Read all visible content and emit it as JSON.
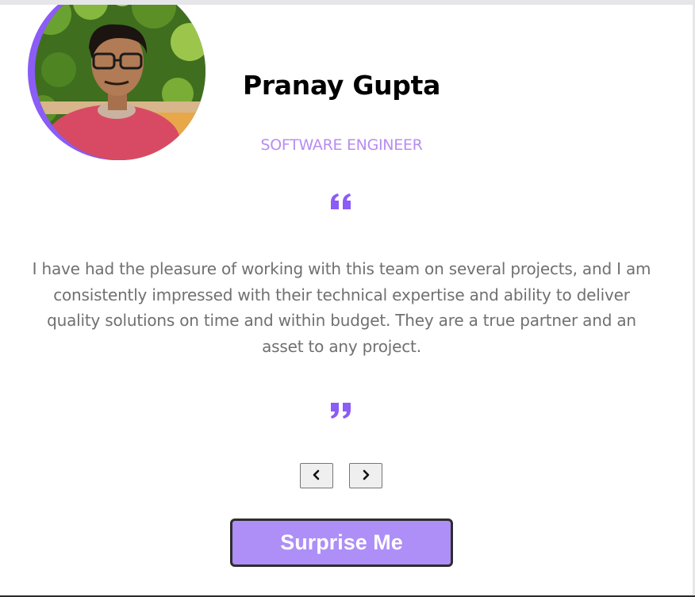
{
  "profile": {
    "name": "Pranay Gupta",
    "job": "SOFTWARE ENGINEER",
    "avatar_alt": "Profile photo"
  },
  "testimonial": {
    "text": "I have had the pleasure of working with this team on several projects, and I am consistently impressed with their technical expertise and ability to deliver quality solutions on time and within budget. They are a true partner and an asset to any project.",
    "open_quote_icon": "quote-left-icon",
    "close_quote_icon": "quote-right-icon"
  },
  "controls": {
    "prev_icon": "chevron-left-icon",
    "next_icon": "chevron-right-icon",
    "surprise_label": "Surprise Me"
  },
  "colors": {
    "accent": "#8b5cf6",
    "job_text": "#b88cf2",
    "body_text": "#707070",
    "button_bg": "#ae8ef7"
  }
}
